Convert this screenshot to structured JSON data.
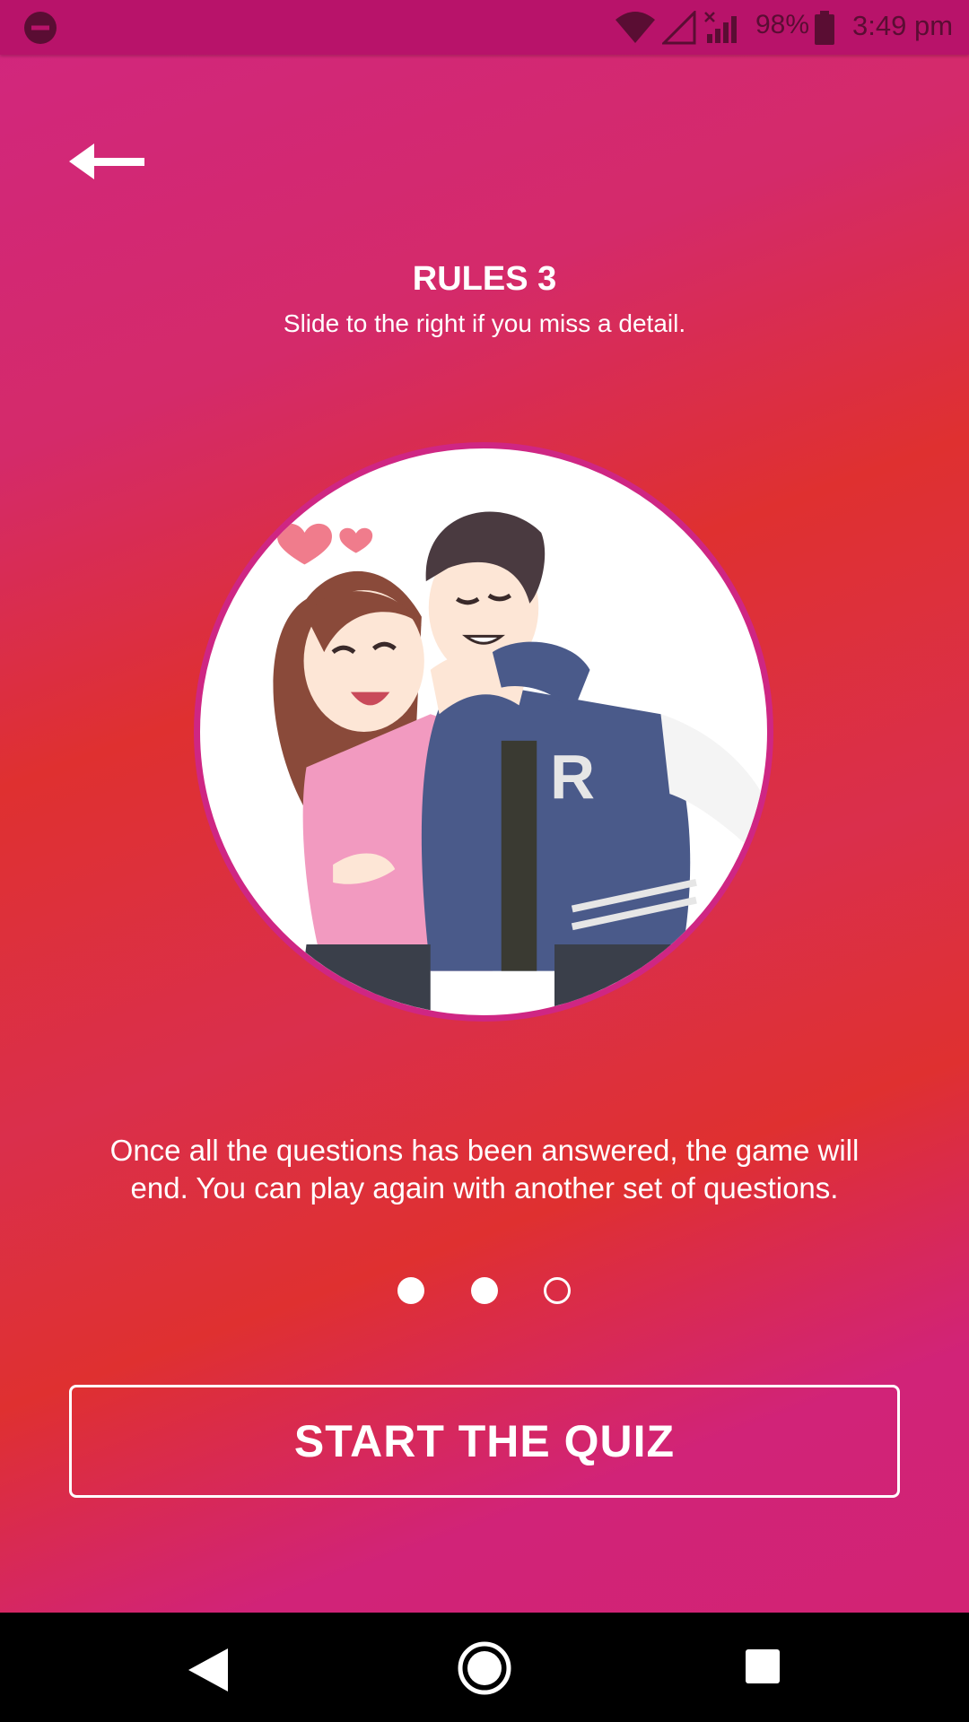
{
  "status_bar": {
    "battery_percent": "98%",
    "time": "3:49 pm",
    "icons": [
      "do-not-disturb-icon",
      "wifi-icon",
      "signal-icon",
      "no-signal-icon",
      "battery-icon"
    ]
  },
  "header": {
    "back_icon": "back-arrow-icon"
  },
  "rules": {
    "title": "RULES 3",
    "subtitle": "Slide to the right if you miss a detail.",
    "description": "Once all the questions has been answered, the game will end. You can play again with another set of questions."
  },
  "pager": {
    "total_pages": 3,
    "active_page": 3
  },
  "actions": {
    "start_label": "START THE QUIZ"
  },
  "colors": {
    "status_bar": "#b8136a",
    "accent_border": "#cf2683",
    "gradient_pink": "#d1267f",
    "gradient_red": "#df3030"
  },
  "nav_bar": {
    "icons": [
      "nav-back-icon",
      "nav-home-icon",
      "nav-recents-icon"
    ]
  }
}
